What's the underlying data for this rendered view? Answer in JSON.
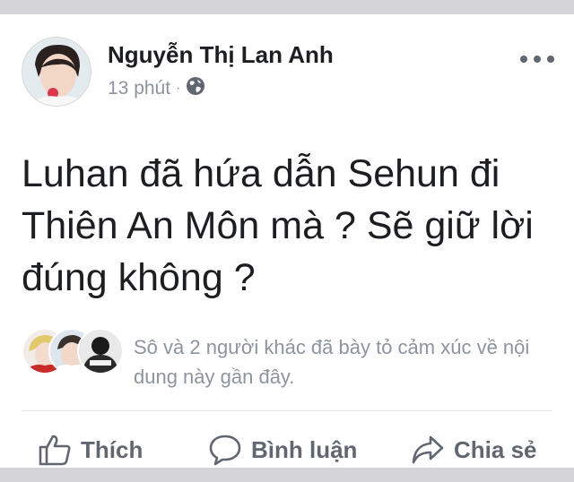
{
  "post": {
    "author": "Nguyễn Thị Lan Anh",
    "time": "13 phút",
    "separator": "·",
    "audience_icon": "globe-icon",
    "text": "Luhan đã hứa dẫn Sehun đi Thiên An Môn mà ? Sẽ giữ lời đúng không ?"
  },
  "reactions": {
    "summary": "Sô và 2 người khác đã bày tỏ cảm xúc về nội dung này gần đây."
  },
  "actions": {
    "like": "Thích",
    "comment": "Bình luận",
    "share": "Chia sẻ"
  },
  "colors": {
    "text": "#1c1e21",
    "secondary": "#8d949e",
    "action": "#606770",
    "background": "#d5d5d8"
  }
}
